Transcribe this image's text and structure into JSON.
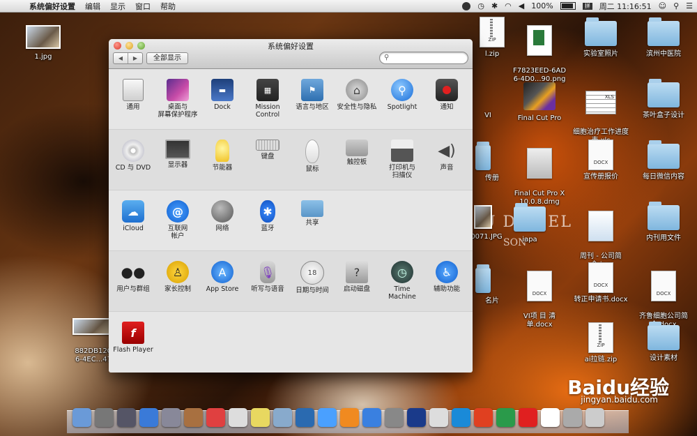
{
  "menubar": {
    "app": "系统偏好设置",
    "items": [
      "编辑",
      "显示",
      "窗口",
      "帮助"
    ],
    "battery": "100%",
    "datetime": "周二 11:16:51"
  },
  "window": {
    "title": "系统偏好设置",
    "show_all": "全部显示",
    "search_placeholder": "",
    "sections": [
      [
        {
          "label": "通用",
          "icon": "general-icon"
        },
        {
          "label": "桌面与\n屏幕保护程序",
          "icon": "desktop-icon"
        },
        {
          "label": "Dock",
          "icon": "dock-icon"
        },
        {
          "label": "Mission\nControl",
          "icon": "mission-control-icon"
        },
        {
          "label": "语言与地区",
          "icon": "language-icon"
        },
        {
          "label": "安全性与隐私",
          "icon": "security-icon"
        },
        {
          "label": "Spotlight",
          "icon": "spotlight-icon"
        },
        {
          "label": "通知",
          "icon": "notification-icon"
        }
      ],
      [
        {
          "label": "CD 与 DVD",
          "icon": "cd-icon"
        },
        {
          "label": "显示器",
          "icon": "display-icon"
        },
        {
          "label": "节能器",
          "icon": "energy-icon"
        },
        {
          "label": "键盘",
          "icon": "keyboard-icon"
        },
        {
          "label": "鼠标",
          "icon": "mouse-icon"
        },
        {
          "label": "触控板",
          "icon": "trackpad-icon"
        },
        {
          "label": "打印机与\n扫描仪",
          "icon": "printer-icon"
        },
        {
          "label": "声音",
          "icon": "sound-icon"
        }
      ],
      [
        {
          "label": "iCloud",
          "icon": "icloud-icon"
        },
        {
          "label": "互联网\n帐户",
          "icon": "internet-accounts-icon"
        },
        {
          "label": "网络",
          "icon": "network-icon"
        },
        {
          "label": "蓝牙",
          "icon": "bluetooth-icon"
        },
        {
          "label": "共享",
          "icon": "sharing-icon"
        }
      ],
      [
        {
          "label": "用户与群组",
          "icon": "users-icon"
        },
        {
          "label": "家长控制",
          "icon": "parental-icon"
        },
        {
          "label": "App Store",
          "icon": "app-store-icon"
        },
        {
          "label": "听写与语音",
          "icon": "dictation-icon"
        },
        {
          "label": "日期与时间",
          "icon": "date-time-icon"
        },
        {
          "label": "启动磁盘",
          "icon": "startup-disk-icon"
        },
        {
          "label": "Time Machine",
          "icon": "time-machine-icon"
        },
        {
          "label": "辅助功能",
          "icon": "accessibility-icon"
        }
      ],
      [
        {
          "label": "Flash Player",
          "icon": "flash-icon"
        }
      ]
    ]
  },
  "desktop": {
    "items": [
      {
        "label": "1.jpg"
      },
      {
        "label": "882DB12C\n6-4EC...47"
      },
      {
        "label": "l.zip"
      },
      {
        "label": "F7823EED-6AD\n6-4D0...90.png"
      },
      {
        "label": "实验室照片"
      },
      {
        "label": "滨州中医院"
      },
      {
        "label": "VI"
      },
      {
        "label": "Final Cut Pro"
      },
      {
        "label": "细胞治疗工作进度\n表.xls"
      },
      {
        "label": "茶叶盒子设计"
      },
      {
        "label": "传册"
      },
      {
        "label": "Final Cut Pro X\n10.0.8.dmg"
      },
      {
        "label": "宣传册报价"
      },
      {
        "label": "每日微信内容"
      },
      {
        "label": "0071.JPG"
      },
      {
        "label": "iapa"
      },
      {
        "label": "周刊 - 公司简\n介.jpg"
      },
      {
        "label": "内刊用文件"
      },
      {
        "label": "名片"
      },
      {
        "label": "VI项 目 清\n单.docx"
      },
      {
        "label": "转正申请书.docx"
      },
      {
        "label": "齐鲁细胞公司简\n介.docx"
      },
      {
        "label": "ai拉链.zip"
      },
      {
        "label": "设计素材"
      }
    ],
    "background_text": "U DE   EEL",
    "background_text2": "SON",
    "watermark": "Baidu经验",
    "watermark_url": "jingyan.baidu.com"
  }
}
